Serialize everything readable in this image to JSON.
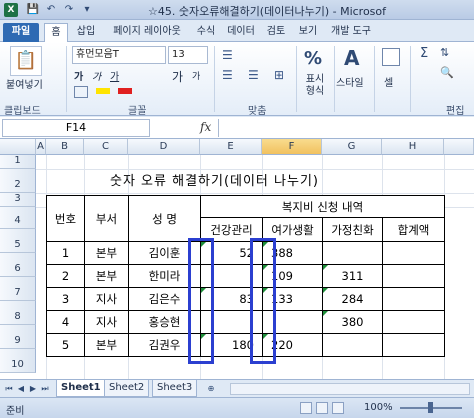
{
  "window": {
    "title": "☆45. 숫자오류해결하기(데이터나누기) - Microsof",
    "qat": [
      "💾",
      "↶",
      "↷",
      "▾"
    ]
  },
  "ribbon_tabs": [
    "파일",
    "홈",
    "삽입",
    "페이지 레이아웃",
    "수식",
    "데이터",
    "검토",
    "보기",
    "개발 도구"
  ],
  "ribbon": {
    "paste_label": "붙여넣기",
    "clipboard_label": "클립보드",
    "font_name": "휴먼모음T",
    "font_size": "13",
    "font_group_label": "글꼴",
    "align_group_label": "맞춤",
    "number_format": "일반",
    "number_group_label": "표시 형식",
    "style_label": "스타일",
    "cells_label": "셀",
    "edit_label": "편집",
    "bold": "가",
    "italic": "가",
    "underline": "가",
    "grow_font": "가",
    "shrink_font": "가",
    "style_symbol": "A",
    "number_symbol": "%"
  },
  "formula_bar": {
    "name_box": "F14",
    "fx": "fx",
    "formula": ""
  },
  "columns": [
    "A",
    "B",
    "C",
    "D",
    "E",
    "F",
    "G",
    "H"
  ],
  "rows": [
    "1",
    "2",
    "3",
    "4",
    "5",
    "6",
    "7",
    "8",
    "9",
    "10"
  ],
  "sheet": {
    "doc_title": "숫자 오류 해결하기(데이터 나누기)",
    "headers": {
      "no": "번호",
      "dept": "부서",
      "name": "성 명",
      "group": "복지비 신청 내역",
      "health": "건강관리",
      "leisure": "여가생활",
      "family": "가정친화",
      "total": "합계액"
    },
    "records": [
      {
        "no": "1",
        "dept": "본부",
        "name": "김이훈",
        "health": "52",
        "leisure": "388",
        "family": "",
        "total": ""
      },
      {
        "no": "2",
        "dept": "본부",
        "name": "한미라",
        "health": "",
        "leisure": "109",
        "family": "311",
        "total": ""
      },
      {
        "no": "3",
        "dept": "지사",
        "name": "김은수",
        "health": "83",
        "leisure": "133",
        "family": "284",
        "total": ""
      },
      {
        "no": "4",
        "dept": "지사",
        "name": "홍승현",
        "health": "",
        "leisure": "",
        "family": "380",
        "total": ""
      },
      {
        "no": "5",
        "dept": "본부",
        "name": "김권우",
        "health": "180",
        "leisure": "220",
        "family": "",
        "total": ""
      }
    ]
  },
  "sheet_tabs": [
    "Sheet1",
    "Sheet2",
    "Sheet3"
  ],
  "status": {
    "mode": "준비",
    "zoom": "100%"
  }
}
